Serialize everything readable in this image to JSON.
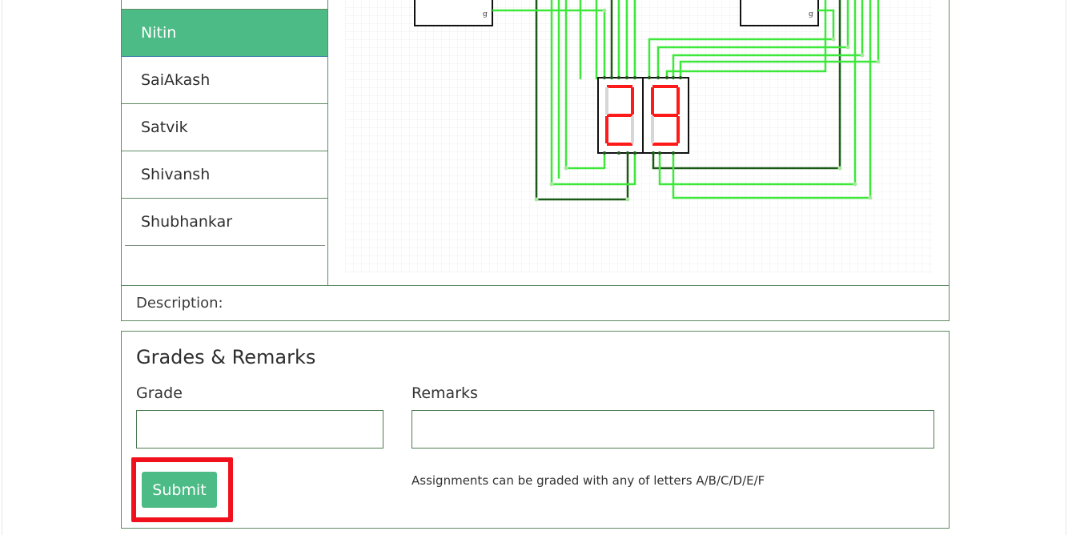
{
  "students": [
    {
      "name": "Nitin",
      "active": true
    },
    {
      "name": "SaiAkash",
      "active": false
    },
    {
      "name": "Satvik",
      "active": false
    },
    {
      "name": "Shivansh",
      "active": false
    },
    {
      "name": "Shubhankar",
      "active": false
    }
  ],
  "circuit": {
    "display_digits": [
      "2",
      "9"
    ],
    "gate_pin_label": "g"
  },
  "description": {
    "label": "Description:"
  },
  "grades": {
    "title": "Grades & Remarks",
    "grade_label": "Grade",
    "grade_value": "",
    "remarks_label": "Remarks",
    "remarks_value": "",
    "submit_label": "Submit",
    "hint": "Assignments can be graded with any of letters A/B/C/D/E/F"
  },
  "colors": {
    "accent": "#4dbb86",
    "border": "#5f8a63",
    "wire_light": "#3de83a",
    "wire_dark": "#1a5a16",
    "segment_on": "#ff1a1a",
    "segment_off": "#cccccc",
    "highlight": "#f0111d"
  }
}
